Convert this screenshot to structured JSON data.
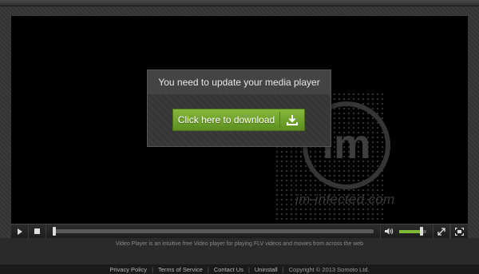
{
  "player": {
    "dialog_title": "You need to update your media player",
    "download_label": "Click here to download",
    "watermark_mark": "im",
    "watermark_text": "im-infected.com",
    "seek_progress": 0.0,
    "volume_level": 0.8
  },
  "controls": {
    "play_icon": "play-icon",
    "stop_icon": "stop-icon",
    "volume_icon": "volume-icon",
    "expand_icon": "expand-icon",
    "fullscreen_icon": "fullscreen-icon"
  },
  "description": "Video Player is an intuitive free Video player for playing FLV videos and movies from across the web",
  "footer": {
    "links": [
      "Privacy Policy",
      "Terms of Service",
      "Contact Us",
      "Uninstall"
    ],
    "copyright": "Copyright © 2013 Somoto Ltd."
  },
  "colors": {
    "button_green": "#6fa52a",
    "volume_green": "#7fb934"
  }
}
